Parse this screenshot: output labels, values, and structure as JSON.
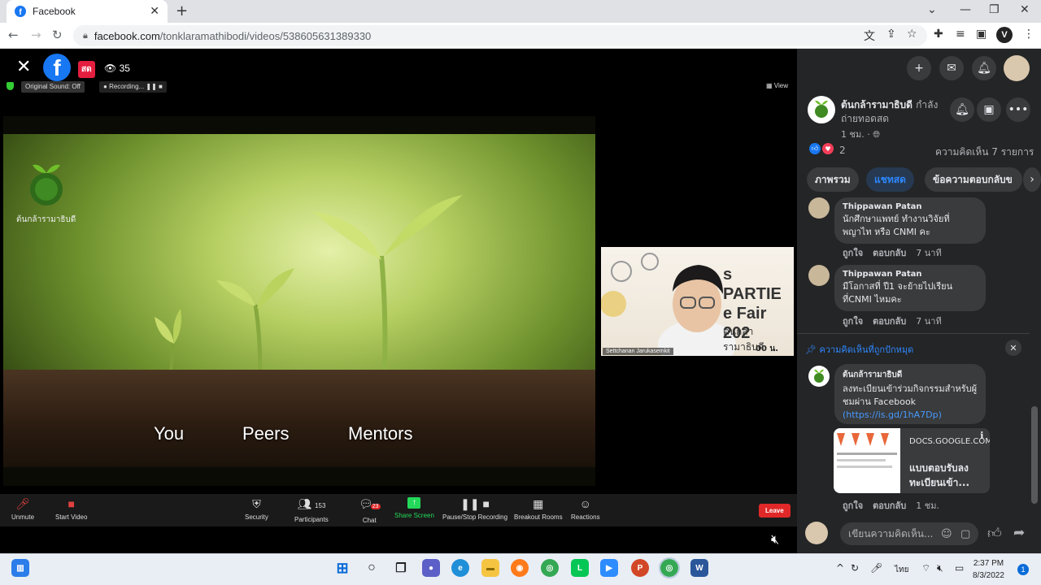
{
  "browser": {
    "tab_title": "Facebook",
    "url_host": "facebook.com",
    "url_path": "/tonklaramathibodi/videos/538605631389330",
    "profile_initial": "V"
  },
  "video": {
    "live_badge": "สด",
    "viewer_count": "35",
    "zoom": {
      "original_sound": "Original Sound: Off",
      "recording": "Recording...",
      "view": "View"
    },
    "slide": {
      "logo_text": "ต้นกล้ารามาธิบดี",
      "captions": [
        "You",
        "Peers",
        "Mentors"
      ]
    },
    "speaker": {
      "name": "Settchanan Jarukasemkit",
      "banner_lines": [
        "s PARTIE",
        "e Fair 202",
        "ต้นกล้ารามาธิบดี",
        "00 น."
      ]
    },
    "toolbar": {
      "unmute": "Unmute",
      "start_video": "Start Video",
      "security": "Security",
      "participants": "Participants",
      "participants_count": "153",
      "chat": "Chat",
      "chat_badge": "23",
      "share_screen": "Share Screen",
      "pause_recording": "Pause/Stop Recording",
      "breakout_rooms": "Breakout Rooms",
      "reactions": "Reactions",
      "leave": "Leave"
    }
  },
  "panel": {
    "page_name": "ต้นกล้ารามาธิบดี",
    "status": "กำลังถ่ายทอดสด",
    "time": "1 ชม. ·",
    "reaction_count": "2",
    "comment_count": "ความคิดเห็น 7 รายการ",
    "tabs": [
      "ภาพรวม",
      "แชทสด",
      "ข้อความตอบกลับข"
    ],
    "actions": {
      "like": "ถูกใจ",
      "reply": "ตอบกลับ"
    },
    "comments": [
      {
        "name": "Thippawan Patan",
        "text": "นักศึกษาแพทย์ ทำงานวิจัยที่พญาไท หรือ CNMI คะ",
        "time": "7 นาที"
      },
      {
        "name": "Thippawan Patan",
        "text": "มีโอกาสที่ ปี1 จะย้ายไปเรียนที่CNMI ไหมคะ",
        "time": "7 นาที"
      }
    ],
    "pinned_label": "ความคิดเห็นที่ถูกปักหมุด",
    "pinned": {
      "name": "ต้นกล้ารามาธิบดี",
      "text": "ลงทะเบียนเข้าร่วมกิจกรรมสำหรับผู้ชมผ่าน Facebook",
      "link": "(https://is.gd/1hA7Dp)",
      "card_domain": "DOCS.GOOGLE.COM",
      "card_title": "แบบตอบรับลงทะเบียนเข้า...",
      "time": "1 ชม."
    },
    "comment_placeholder": "เขียนความคิดเห็น..."
  },
  "taskbar": {
    "time": "2:37 PM",
    "date": "8/3/2022",
    "language": "ไทย",
    "notification_count": "1"
  },
  "colors": {
    "facebook_blue": "#1877f2",
    "live_red": "#e41e3f",
    "panel_bg": "#242526",
    "leave_red": "#e02828",
    "share_green": "#23d959"
  }
}
